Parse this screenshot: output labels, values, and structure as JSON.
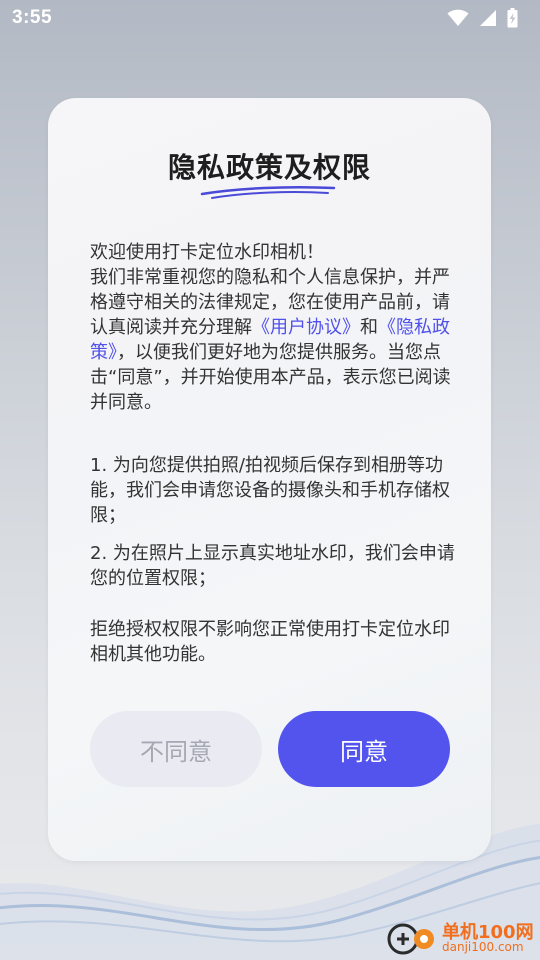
{
  "status_bar": {
    "time": "3:55"
  },
  "dialog": {
    "title": "隐私政策及权限",
    "intro_line1": "欢迎使用打卡定位水印相机！",
    "intro_line2_before": "我们非常重视您的隐私和个人信息保护，并严格遵守相关的法律规定，您在使用产品前，请认真阅读并充分理解",
    "user_agreement_link": "《用户协议》",
    "intro_and": "和",
    "privacy_policy_link": "《隐私政策》",
    "intro_line2_after": "，以便我们更好地为您提供服务。当您点击“同意”，并开始使用本产品，表示您已阅读并同意。",
    "item1": "1. 为向您提供拍照/拍视频后保存到相册等功能，我们会申请您设备的摄像头和手机存储权限；",
    "item2": "2. 为在照片上显示真实地址水印，我们会申请您的位置权限；",
    "note": "拒绝授权权限不影响您正常使用打卡定位水印相机其他功能。",
    "disagree_label": "不同意",
    "agree_label": "同意"
  },
  "watermark": {
    "name": "单机100网",
    "domain": "danji100.com"
  },
  "colors": {
    "accent": "#5254ed",
    "link": "#5050ea",
    "disagree_bg": "#eaebf2"
  }
}
